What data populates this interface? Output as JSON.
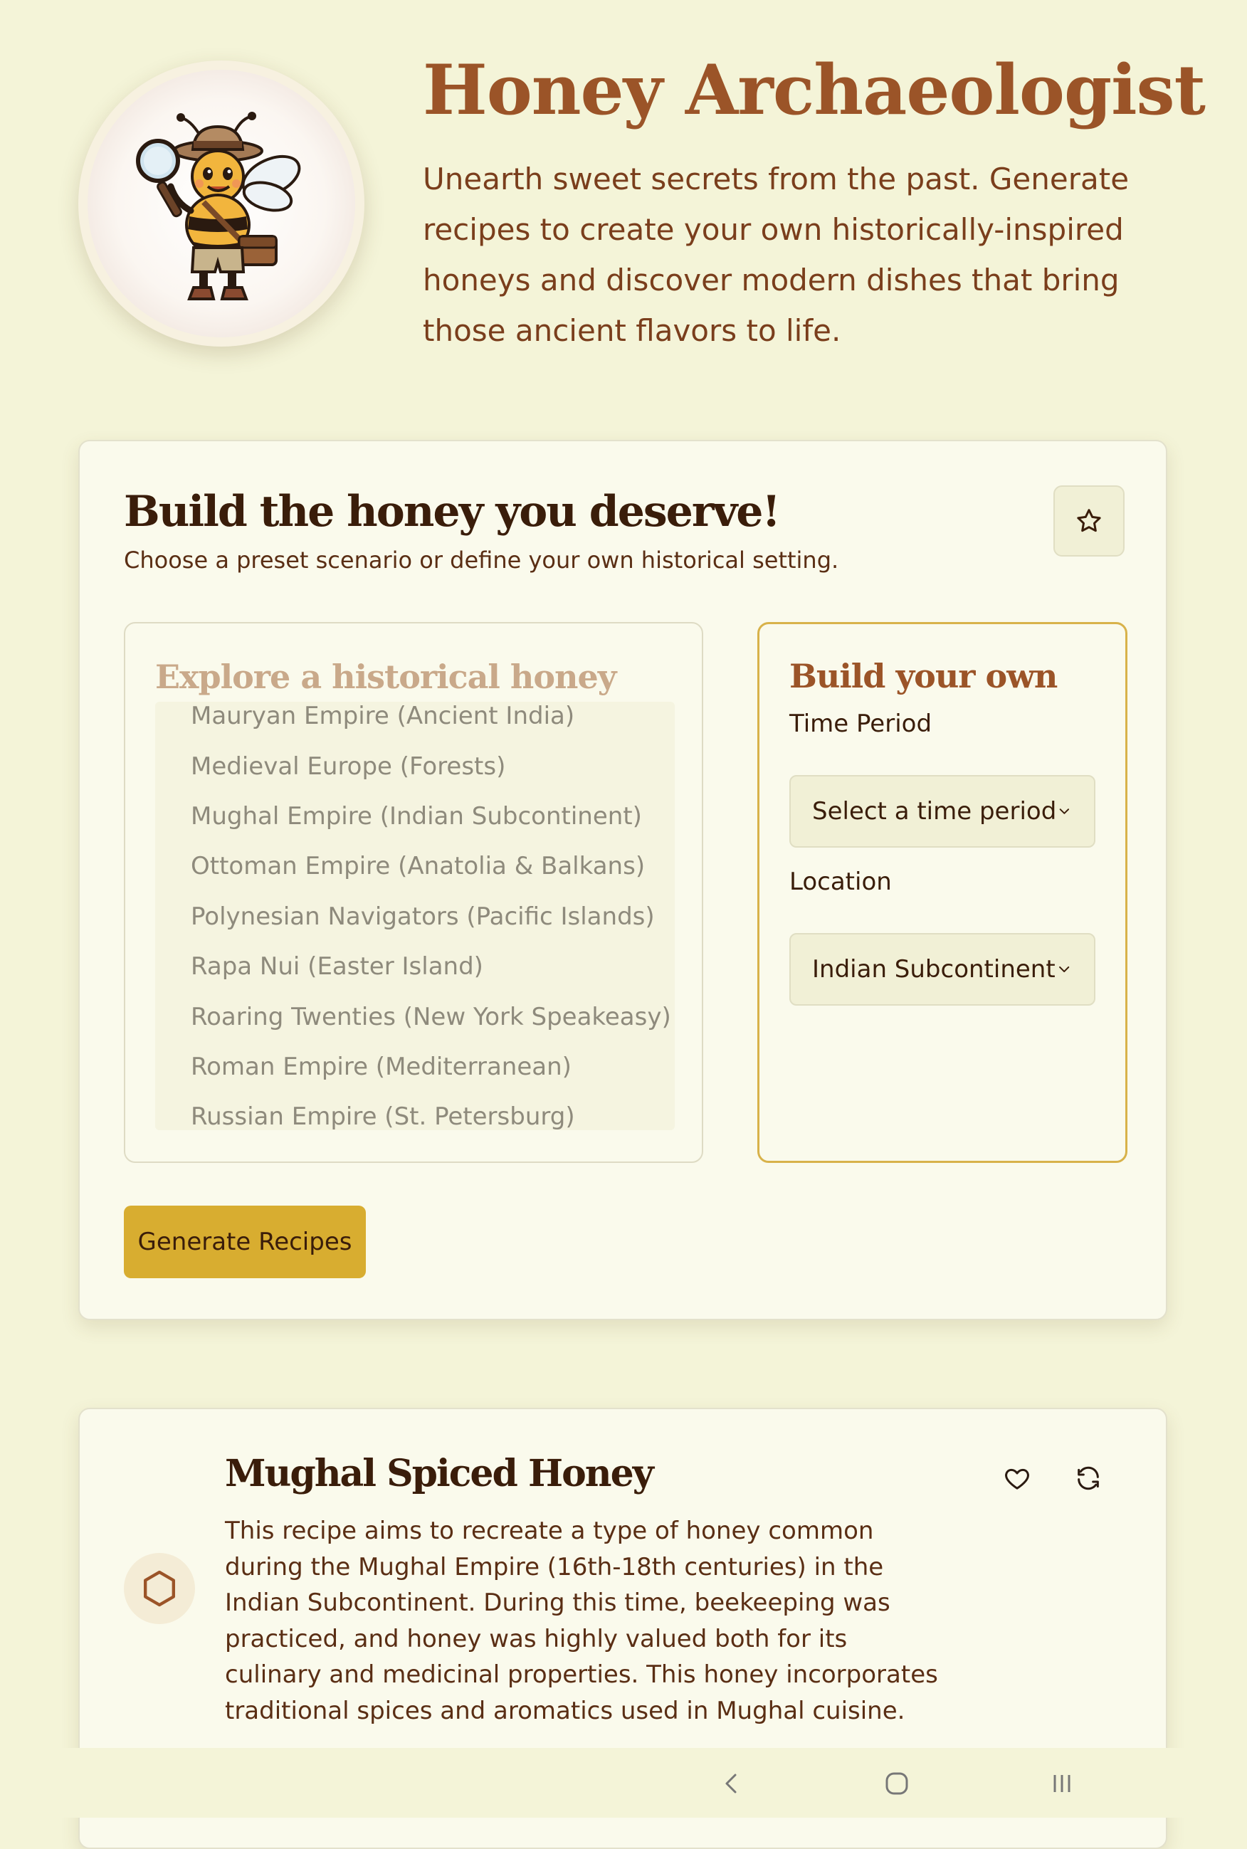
{
  "header": {
    "title": "Honey Archaeologist",
    "description": "Unearth sweet secrets from the past. Generate recipes to create your own historically-inspired honeys and discover modern dishes that bring those ancient flavors to life.",
    "avatar_icon": "bee-explorer-icon"
  },
  "builder": {
    "title": "Build the honey you deserve!",
    "subtitle": "Choose a preset scenario or define your own historical setting.",
    "favorite_icon": "star-icon",
    "preset": {
      "title": "Explore a historical honey",
      "items": [
        "Mauryan Empire (Ancient India)",
        "Medieval Europe (Forests)",
        "Mughal Empire (Indian Subcontinent)",
        "Ottoman Empire (Anatolia & Balkans)",
        "Polynesian Navigators (Pacific Islands)",
        "Rapa Nui (Easter Island)",
        "Roaring Twenties (New York Speakeasy)",
        "Roman Empire (Mediterranean)",
        "Russian Empire (St. Petersburg)"
      ]
    },
    "custom": {
      "title": "Build your own",
      "time_period_label": "Time Period",
      "time_period_value": "Select a time period",
      "location_label": "Location",
      "location_value": "Indian Subcontinent"
    },
    "generate_label": "Generate Recipes"
  },
  "recipe": {
    "title": "Mughal Spiced Honey",
    "description": "This recipe aims to recreate a type of honey common during the Mughal Empire (16th-18th centuries) in the Indian Subcontinent. During this time, beekeeping was practiced, and honey was highly valued both for its culinary and medicinal properties. This honey incorporates traditional spices and aromatics used in Mughal cuisine.",
    "icon": "hexagon-icon",
    "favorite_icon": "heart-icon",
    "regenerate_icon": "refresh-icon"
  },
  "nav": {
    "back_icon": "back-icon",
    "home_icon": "home-icon",
    "recents_icon": "recents-icon"
  },
  "colors": {
    "background": "#f4f4d8",
    "card": "#fafaec",
    "brand_brown": "#9b5428",
    "accent_gold": "#d8ad30"
  }
}
